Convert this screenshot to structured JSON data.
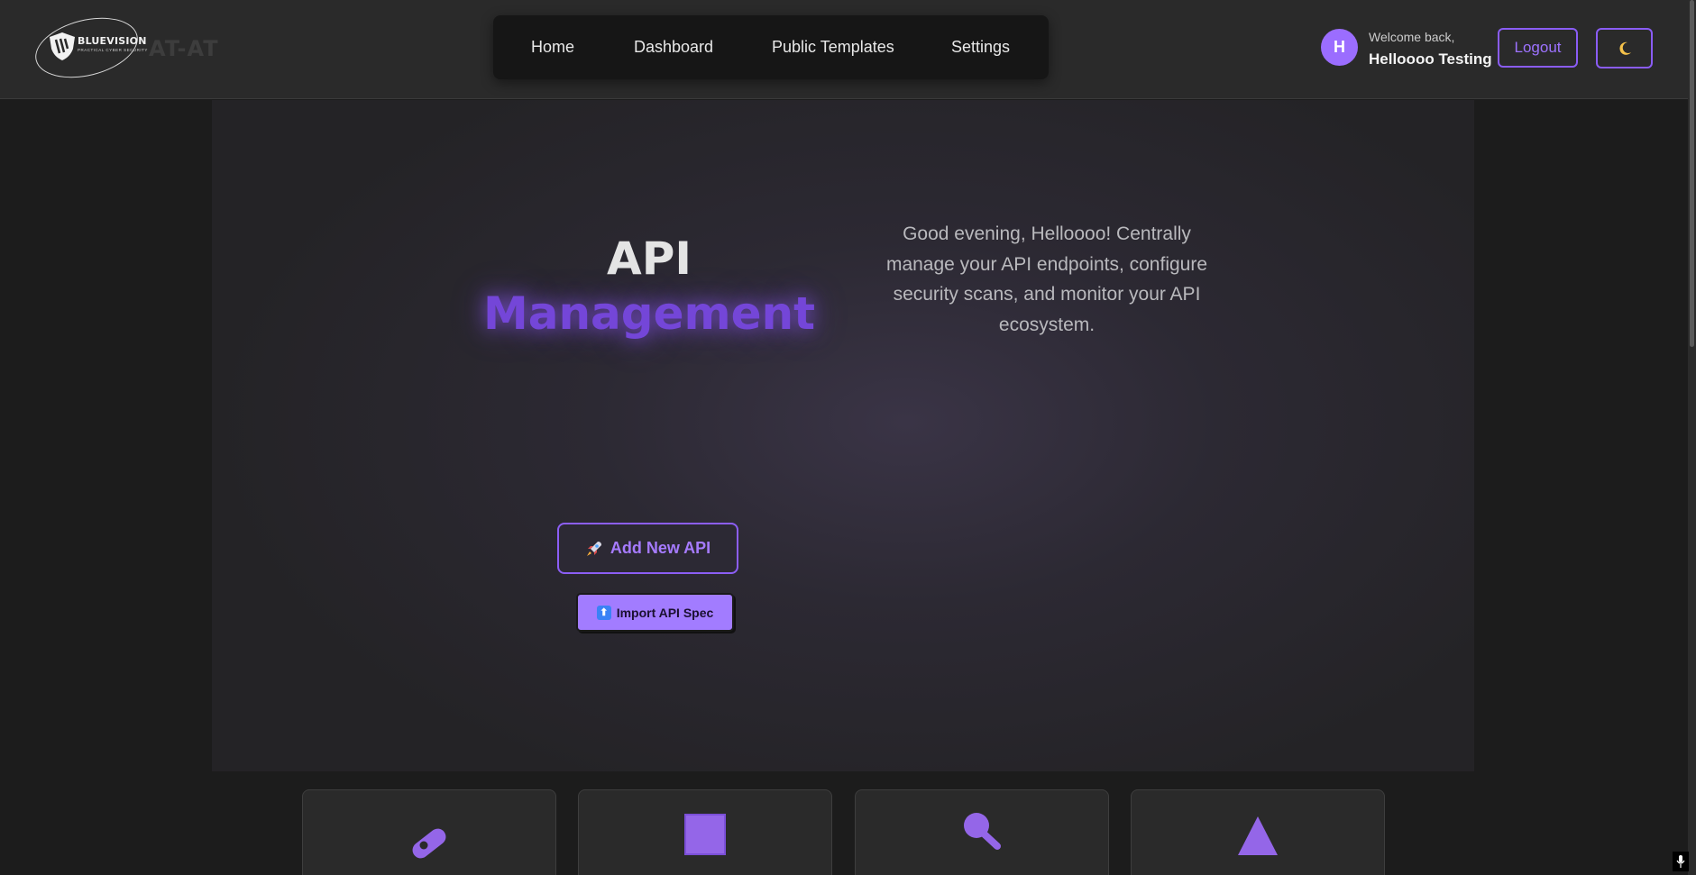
{
  "header": {
    "logo": {
      "brand": "BLUEVISION",
      "tagline": "PRACTICAL CYBER SECURITY"
    },
    "app_name": "AT-AT",
    "nav": [
      {
        "label": "Home"
      },
      {
        "label": "Dashboard"
      },
      {
        "label": "Public Templates"
      },
      {
        "label": "Settings"
      }
    ],
    "user": {
      "avatar_initial": "H",
      "welcome_label": "Welcome back,",
      "name": "Helloooo Testing"
    },
    "logout_label": "Logout",
    "theme_toggle_icon": "moon-icon"
  },
  "hero": {
    "title_line1": "API",
    "title_line2": "Management",
    "description": "Good evening, Helloooo! Centrally manage your API endpoints, configure security scans, and monitor your API ecosystem.",
    "add_button": {
      "icon": "rocket-icon",
      "label": "Add New API"
    },
    "import_button": {
      "icon": "upload-arrow-icon",
      "label": "Import API Spec"
    }
  },
  "feature_cards": [
    {
      "icon": "pill-icon"
    },
    {
      "icon": "square-icon"
    },
    {
      "icon": "magnifier-icon"
    },
    {
      "icon": "triangle-icon"
    }
  ],
  "colors": {
    "accent": "#8a5cf5",
    "accent_light": "#a27cff",
    "header_bg": "#2a2a2a",
    "page_bg": "#1c1c1c"
  }
}
